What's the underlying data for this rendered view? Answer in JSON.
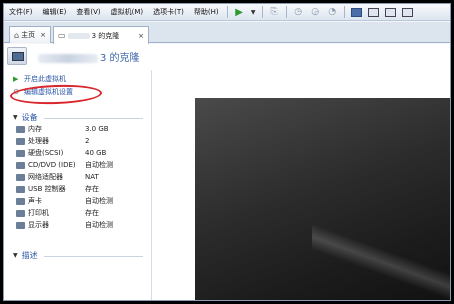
{
  "menu": [
    "文件(F)",
    "编辑(E)",
    "查看(V)",
    "虚拟机(M)",
    "选项卡(T)",
    "帮助(H)"
  ],
  "tabs": [
    {
      "label": "主页",
      "icon": "home-icon"
    },
    {
      "label": "3 的克隆",
      "icon": "vm-icon"
    }
  ],
  "vm": {
    "title_suffix": "3 的克隆"
  },
  "actions": {
    "power_on": "开启此虚拟机",
    "edit_settings": "编辑虚拟机设置"
  },
  "devices_heading": "设备",
  "devices": [
    {
      "icon": "memory-icon",
      "name": "内存",
      "value": "3.0 GB"
    },
    {
      "icon": "cpu-icon",
      "name": "处理器",
      "value": "2"
    },
    {
      "icon": "disk-icon",
      "name": "硬盘(SCSI)",
      "value": "40 GB"
    },
    {
      "icon": "cdrom-icon",
      "name": "CD/DVD (IDE)",
      "value": "自动检测"
    },
    {
      "icon": "network-icon",
      "name": "网络适配器",
      "value": "NAT"
    },
    {
      "icon": "usb-icon",
      "name": "USB 控制器",
      "value": "存在"
    },
    {
      "icon": "sound-icon",
      "name": "声卡",
      "value": "自动检测"
    },
    {
      "icon": "printer-icon",
      "name": "打印机",
      "value": "存在"
    },
    {
      "icon": "display-icon",
      "name": "显示器",
      "value": "自动检测"
    }
  ],
  "description_heading": "描述",
  "colors": {
    "link_blue": "#2a55a8",
    "highlight_red": "#d8262c",
    "play_green": "#2e9a2e"
  }
}
